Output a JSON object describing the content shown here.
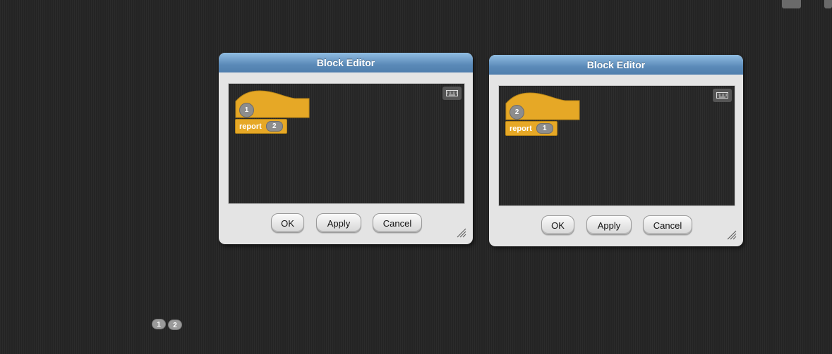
{
  "dialogs": [
    {
      "title": "Block Editor",
      "param": "1",
      "report_label": "report",
      "report_value": "2",
      "buttons": {
        "ok": "OK",
        "apply": "Apply",
        "cancel": "Cancel"
      }
    },
    {
      "title": "Block Editor",
      "param": "2",
      "report_label": "report",
      "report_value": "1",
      "buttons": {
        "ok": "OK",
        "apply": "Apply",
        "cancel": "Cancel"
      }
    }
  ],
  "stage_badges": [
    "1",
    "2"
  ],
  "colors": {
    "block_orange": "#e6a826",
    "titlebar_blue": "#5b8ab8",
    "background": "#282828",
    "param_gray": "#8d8d8d"
  },
  "icons": [
    "keyboard-icon",
    "resize-handle-icon",
    "undo-icon"
  ]
}
